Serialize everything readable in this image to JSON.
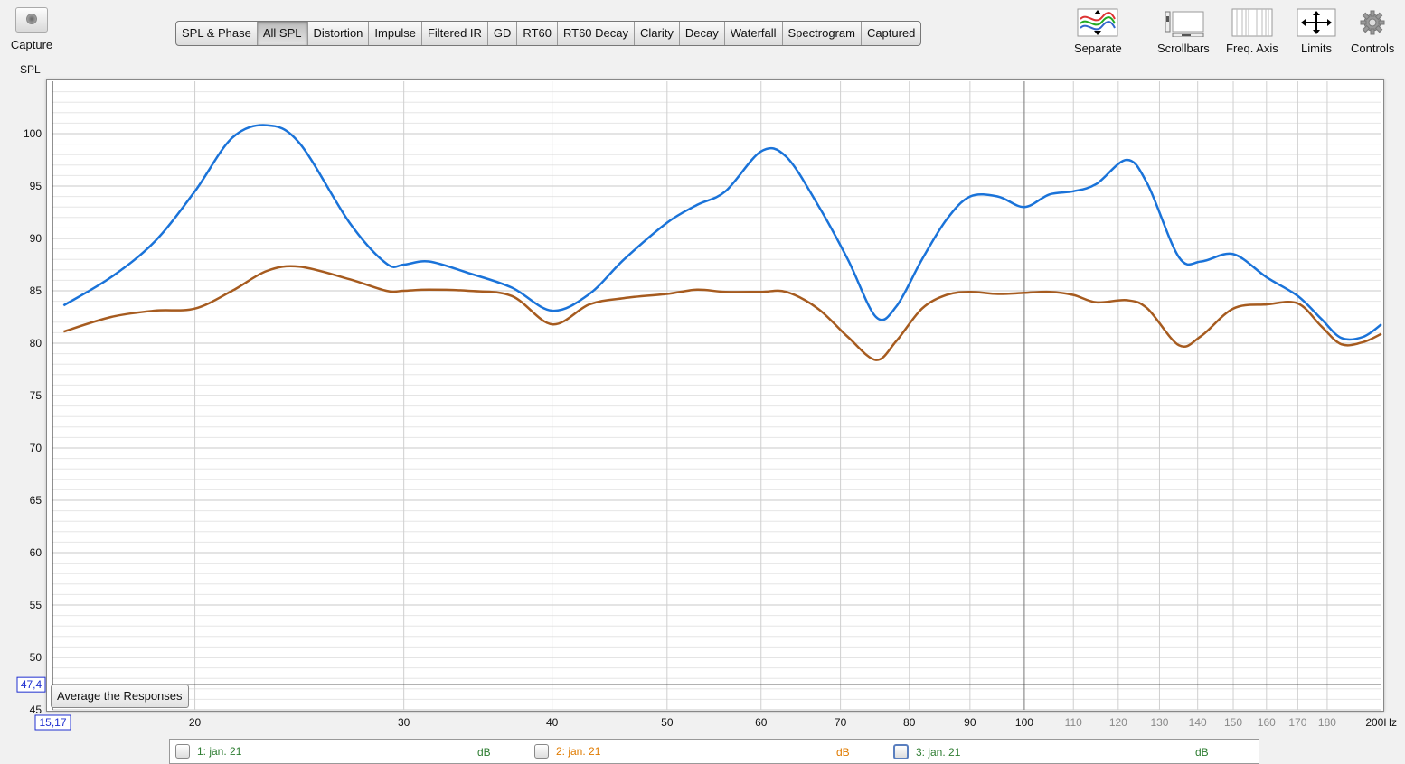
{
  "capture": {
    "label": "Capture",
    "icon": "camera-icon"
  },
  "panel_title": "SPL",
  "tabs": [
    {
      "label": "SPL & Phase",
      "active": false
    },
    {
      "label": "All SPL",
      "active": true
    },
    {
      "label": "Distortion",
      "active": false
    },
    {
      "label": "Impulse",
      "active": false
    },
    {
      "label": "Filtered IR",
      "active": false
    },
    {
      "label": "GD",
      "active": false
    },
    {
      "label": "RT60",
      "active": false
    },
    {
      "label": "RT60 Decay",
      "active": false
    },
    {
      "label": "Clarity",
      "active": false
    },
    {
      "label": "Decay",
      "active": false
    },
    {
      "label": "Waterfall",
      "active": false
    },
    {
      "label": "Spectrogram",
      "active": false
    },
    {
      "label": "Captured",
      "active": false
    }
  ],
  "toolbar": {
    "separate": "Separate",
    "scrollbars": "Scrollbars",
    "freq_axis": "Freq. Axis",
    "limits": "Limits",
    "controls": "Controls"
  },
  "average_button": "Average the Responses",
  "readouts": {
    "y_value": "47,4",
    "x_value": "15,17"
  },
  "legend": [
    {
      "label": "1: jan. 21",
      "unit": "dB",
      "color": "#2e7d32"
    },
    {
      "label": "2: jan. 21",
      "unit": "dB",
      "color": "#e07b00"
    },
    {
      "label": "3: jan. 21",
      "unit": "dB",
      "color": "#2e7d32"
    }
  ],
  "chart_data": {
    "type": "line",
    "xscale": "log",
    "xlim": [
      15.17,
      200
    ],
    "ylim": [
      45,
      105
    ],
    "major_x_ticks": [
      20,
      30,
      40,
      50,
      60,
      70,
      80,
      90,
      100
    ],
    "minor_x_ticks": [
      110,
      120,
      130,
      140,
      150,
      160,
      170,
      180
    ],
    "x_end_label": "200Hz",
    "y_ticks": [
      45,
      50,
      55,
      60,
      65,
      70,
      75,
      80,
      85,
      90,
      95,
      100
    ],
    "cursor": {
      "x": 15.17,
      "y": 47.4
    },
    "grid": true,
    "series": [
      {
        "color": "#1a73d9",
        "x": [
          15.5,
          17,
          18.5,
          20,
          21.5,
          23,
          24.5,
          27,
          29,
          30,
          31.5,
          34,
          37,
          40,
          43,
          46,
          50,
          53,
          56,
          60,
          63,
          67,
          71,
          75,
          78,
          82,
          86,
          90,
          95,
          100,
          105,
          110,
          115,
          122,
          127,
          135,
          141,
          150,
          160,
          170,
          178,
          185,
          193,
          200
        ],
        "y": [
          83.6,
          86.3,
          89.7,
          94.5,
          99.6,
          100.8,
          99.1,
          91.5,
          87.6,
          87.5,
          87.8,
          86.7,
          85.3,
          83.1,
          84.7,
          88,
          91.5,
          93.2,
          94.5,
          98.3,
          97.8,
          93.2,
          88,
          82.5,
          83.5,
          88,
          91.8,
          94,
          94,
          93,
          94.2,
          94.5,
          95.2,
          97.5,
          95.2,
          88.2,
          87.8,
          88.5,
          86.3,
          84.5,
          82.3,
          80.5,
          80.6,
          81.8
        ]
      },
      {
        "color": "#a65b1f",
        "x": [
          15.5,
          17,
          18.5,
          20,
          21.5,
          23,
          24.5,
          27,
          29,
          30,
          31.5,
          34,
          37,
          40,
          43,
          46,
          50,
          53,
          56,
          60,
          63,
          67,
          71,
          75,
          78,
          82,
          86,
          90,
          95,
          100,
          105,
          110,
          115,
          122,
          127,
          135,
          141,
          150,
          160,
          170,
          178,
          185,
          193,
          200
        ],
        "y": [
          81.1,
          82.5,
          83.1,
          83.3,
          85,
          86.9,
          87.3,
          86.1,
          85,
          85,
          85.1,
          85,
          84.5,
          81.8,
          83.7,
          84.3,
          84.7,
          85.1,
          84.9,
          84.9,
          84.9,
          83.3,
          80.6,
          78.4,
          80.2,
          83.3,
          84.6,
          84.9,
          84.7,
          84.8,
          84.9,
          84.6,
          83.9,
          84.1,
          83.3,
          79.8,
          80.7,
          83.3,
          83.7,
          83.8,
          81.6,
          79.9,
          80.1,
          80.9
        ]
      }
    ]
  }
}
